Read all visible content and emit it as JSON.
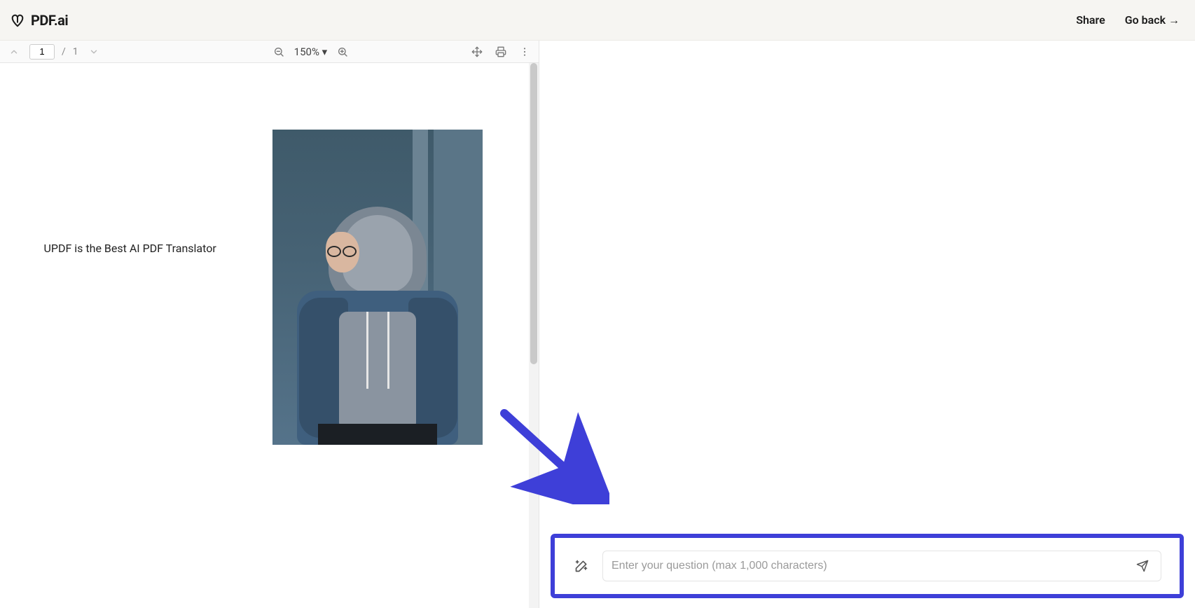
{
  "header": {
    "brand": "PDF.ai",
    "share": "Share",
    "go_back": "Go back →"
  },
  "pdf_toolbar": {
    "page_current": "1",
    "page_total": "1",
    "page_sep": "/",
    "zoom": "150% ▾"
  },
  "document": {
    "line1": "UPDF is the Best AI PDF Translator"
  },
  "chat": {
    "placeholder": "Enter your question (max 1,000 characters)"
  },
  "colors": {
    "highlight": "#3e3fd8"
  }
}
